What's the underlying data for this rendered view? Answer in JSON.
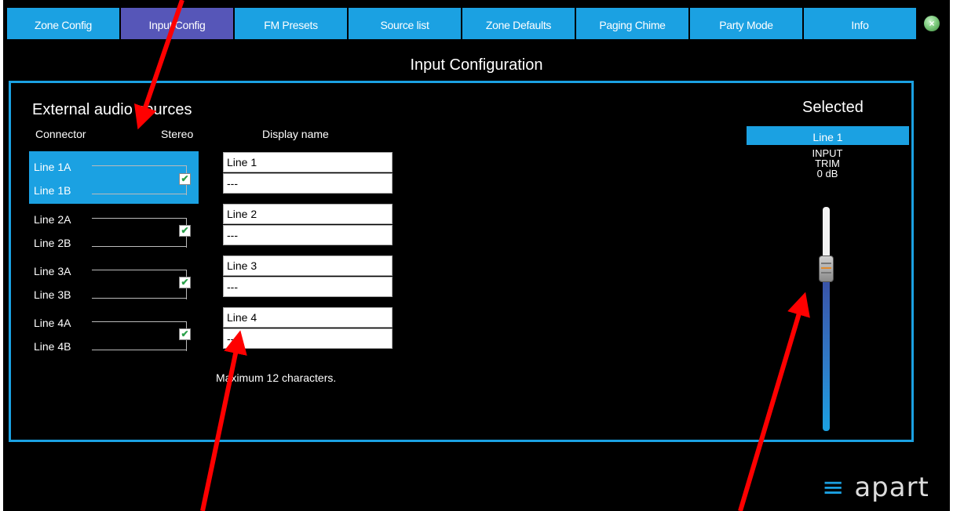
{
  "tabs": [
    {
      "label": "Zone Config",
      "active": false
    },
    {
      "label": "Input Config",
      "active": true
    },
    {
      "label": "FM Presets",
      "active": false
    },
    {
      "label": "Source list",
      "active": false
    },
    {
      "label": "Zone Defaults",
      "active": false
    },
    {
      "label": "Paging Chime",
      "active": false
    },
    {
      "label": "Party Mode",
      "active": false
    },
    {
      "label": "Info",
      "active": false
    }
  ],
  "close_icon": "close-icon",
  "page_title": "Input Configuration",
  "section": {
    "title": "External audio sources",
    "col_connector": "Connector",
    "col_stereo": "Stereo",
    "col_display_name": "Display name"
  },
  "groups": [
    {
      "line_a": "Line 1A",
      "line_b": "Line 1B",
      "stereo": true,
      "selected": true,
      "name_a": "Line 1",
      "name_b": "---"
    },
    {
      "line_a": "Line 2A",
      "line_b": "Line 2B",
      "stereo": true,
      "selected": false,
      "name_a": "Line 2",
      "name_b": "---"
    },
    {
      "line_a": "Line 3A",
      "line_b": "Line 3B",
      "stereo": true,
      "selected": false,
      "name_a": "Line 3",
      "name_b": "---"
    },
    {
      "line_a": "Line 4A",
      "line_b": "Line 4B",
      "stereo": true,
      "selected": false,
      "name_a": "Line 4",
      "name_b": "---"
    }
  ],
  "hint": "Maximum 12 characters.",
  "selected_panel": {
    "title": "Selected",
    "selected_input": "Line 1",
    "trim_line1": "INPUT",
    "trim_line2": "TRIM",
    "trim_value": "0 dB",
    "trim_level_fraction": 0.28
  },
  "logo": {
    "glyph": "≡",
    "text": "apart"
  },
  "colors": {
    "accent": "#1ba1e2",
    "active_tab": "#5656b8",
    "annotation": "#ff0000"
  }
}
